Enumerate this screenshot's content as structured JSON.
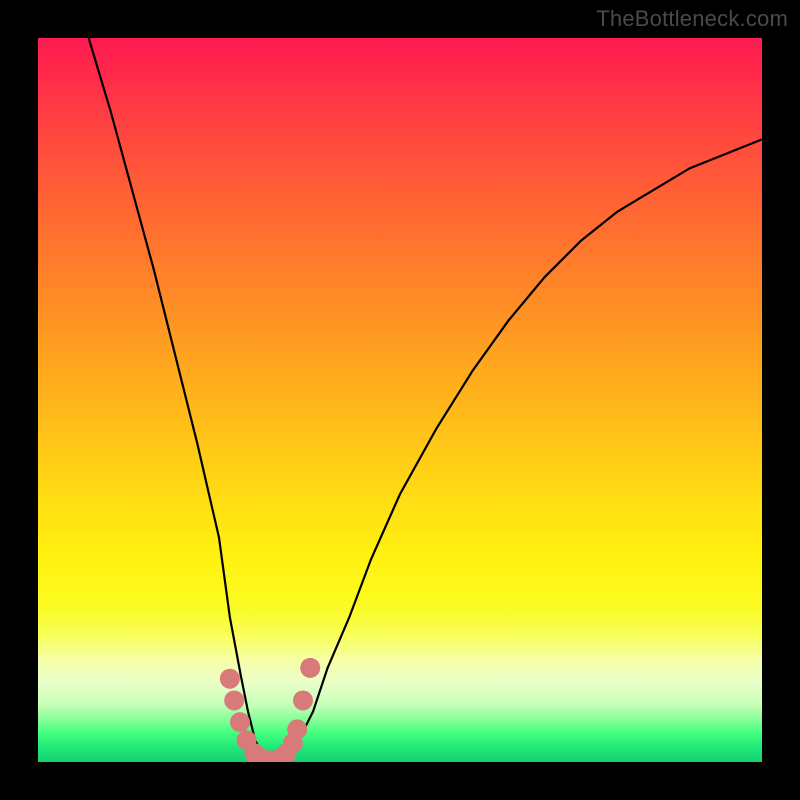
{
  "watermark": {
    "text": "TheBottleneck.com"
  },
  "chart_data": {
    "type": "line",
    "title": "",
    "xlabel": "",
    "ylabel": "",
    "xlim": [
      0,
      100
    ],
    "ylim": [
      0,
      100
    ],
    "grid": false,
    "series": [
      {
        "name": "curve",
        "color": "#000000",
        "x": [
          7,
          10,
          13,
          16,
          19,
          22,
          25,
          26.5,
          28,
          29,
          30,
          31,
          32,
          33,
          34,
          35,
          36,
          38,
          40,
          43,
          46,
          50,
          55,
          60,
          65,
          70,
          75,
          80,
          85,
          90,
          95,
          100
        ],
        "y": [
          100,
          90,
          79,
          68,
          56,
          44,
          31,
          20,
          12,
          7,
          3,
          1,
          0,
          0,
          0,
          1,
          3,
          7,
          13,
          20,
          28,
          37,
          46,
          54,
          61,
          67,
          72,
          76,
          79,
          82,
          84,
          86
        ]
      },
      {
        "name": "bottom-markers",
        "type": "scatter",
        "color": "#d97a7a",
        "x": [
          26.5,
          27.1,
          27.9,
          28.8,
          29.9,
          31.0,
          32.1,
          33.3,
          34.3,
          35.2,
          35.8,
          36.6,
          37.6
        ],
        "y": [
          11.5,
          8.5,
          5.5,
          3.0,
          1.2,
          0.4,
          0.2,
          0.4,
          1.2,
          2.6,
          4.5,
          8.5,
          13.0
        ]
      }
    ],
    "background": {
      "type": "vertical-gradient",
      "stops": [
        {
          "offset": 0.0,
          "color": "#ff1a52"
        },
        {
          "offset": 0.35,
          "color": "#ff7f2a"
        },
        {
          "offset": 0.7,
          "color": "#fff210"
        },
        {
          "offset": 0.9,
          "color": "#c8ffb8"
        },
        {
          "offset": 1.0,
          "color": "#18d070"
        }
      ]
    }
  }
}
